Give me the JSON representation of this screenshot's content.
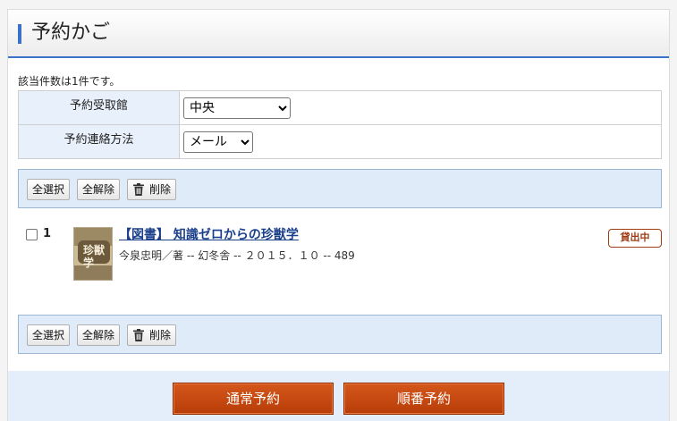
{
  "header": {
    "title": "予約かご"
  },
  "result_count": "該当件数は1件です。",
  "form": {
    "pickup_label": "予約受取館",
    "pickup_value": "中央",
    "contact_label": "予約連絡方法",
    "contact_value": "メール"
  },
  "toolbar": {
    "select_all": "全選択",
    "clear_all": "全解除",
    "delete": "削除"
  },
  "items": [
    {
      "number": "1",
      "cover_text": "珍獣学",
      "title": "【図書】 知識ゼロからの珍獣学",
      "meta": "今泉忠明／著 -- 幻冬舎 -- ２０１５．１０ -- 489",
      "status": "貸出中"
    }
  ],
  "footer": {
    "normal_reserve": "通常予約",
    "sequential_reserve": "順番予約"
  },
  "colors": {
    "accent": "#3a72c9",
    "toolbar_bg": "#dfebf8",
    "reserve_button": "#c8490e",
    "status_border": "#a03c14"
  }
}
